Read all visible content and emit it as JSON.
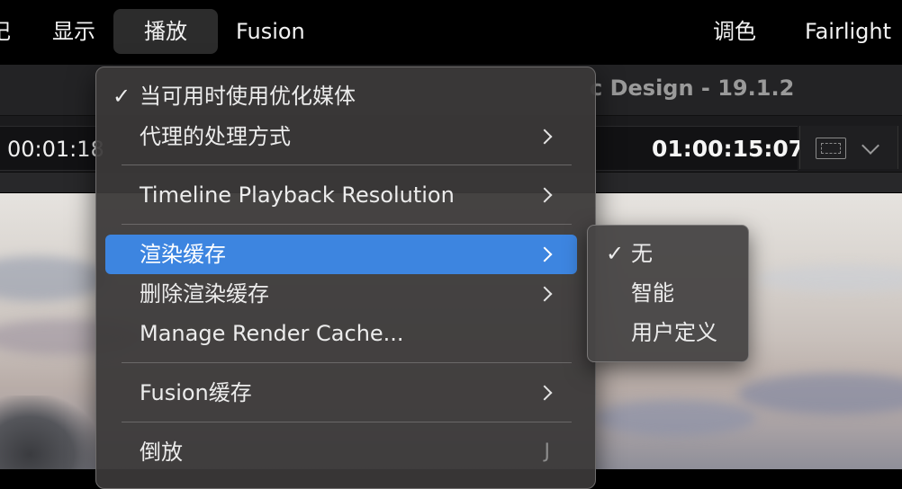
{
  "menubar": {
    "items": [
      {
        "label": "记"
      },
      {
        "label": "显示"
      },
      {
        "label": "播放"
      },
      {
        "label": "Fusion"
      },
      {
        "label": "调色"
      },
      {
        "label": "Fairlight"
      }
    ]
  },
  "window": {
    "title": "c Design - 19.1.2",
    "timecode_left": "00:01:18",
    "timecode_right": "01:00:15:07",
    "view_icons": [
      "fit-to-frame-icon",
      "chevron-down-icon"
    ]
  },
  "playback_menu": {
    "items": [
      {
        "label": "当可用时使用优化媒体",
        "checked": true
      },
      {
        "label": "代理的处理方式",
        "submenu": true
      },
      {
        "label": "Timeline Playback Resolution",
        "submenu": true
      },
      {
        "label": "渲染缓存",
        "submenu": true,
        "highlighted": true
      },
      {
        "label": "删除渲染缓存",
        "submenu": true
      },
      {
        "label": "Manage Render Cache..."
      },
      {
        "label": "Fusion缓存",
        "submenu": true
      },
      {
        "label": "倒放",
        "shortcut": "J"
      }
    ],
    "checkmark": "✓"
  },
  "render_cache_submenu": {
    "items": [
      {
        "label": "无",
        "checked": true
      },
      {
        "label": "智能",
        "checked": false
      },
      {
        "label": "用户定义",
        "checked": false
      }
    ]
  },
  "colors": {
    "highlight": "#3d85e0",
    "menu_bg": "#3a3838",
    "menubar_bg": "#000000"
  }
}
